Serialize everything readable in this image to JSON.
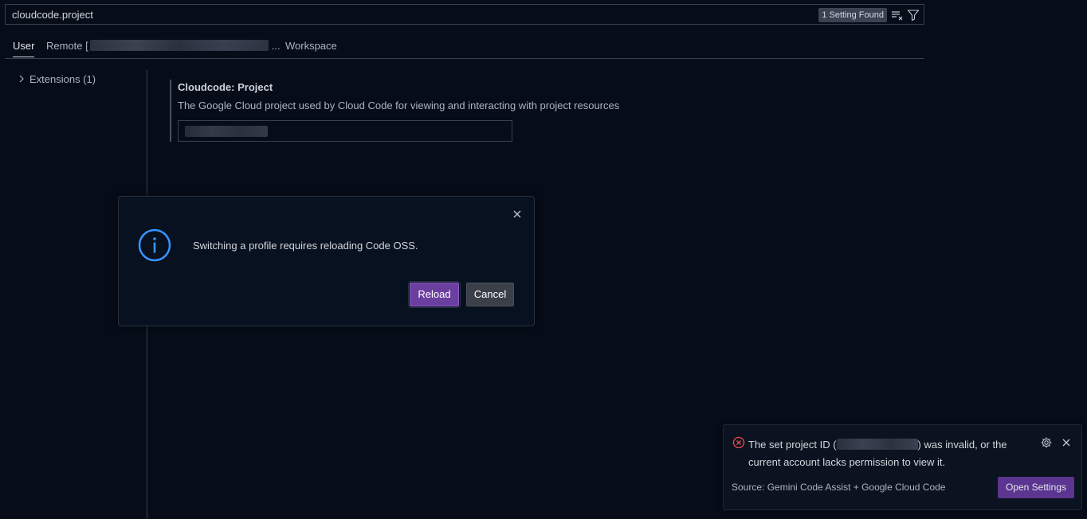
{
  "search": {
    "value": "cloudcode.project",
    "result_count": "1 Setting Found",
    "clear_icon": "clear-filter-icon",
    "filter_icon": "filter-icon"
  },
  "tabs": {
    "user": "User",
    "remote_prefix": "Remote [",
    "remote_suffix": "...",
    "workspace": "Workspace"
  },
  "toc": {
    "extensions": "Extensions (1)"
  },
  "setting": {
    "category": "Cloudcode: ",
    "name": "Project",
    "description": "The Google Cloud project used by Cloud Code for viewing and interacting with project resources"
  },
  "dialog": {
    "message": "Switching a profile requires reloading Code OSS.",
    "reload_label": "Reload",
    "cancel_label": "Cancel",
    "icon": "info-icon",
    "accent_color": "#3794ff",
    "primary_button_color": "#6b3fa0"
  },
  "notification": {
    "message_part1": "The set project ID (",
    "message_part2": ") was invalid, or the current account lacks permission to view it.",
    "source": "Source: Gemini Code Assist + Google Cloud Code",
    "button_label": "Open Settings",
    "icon": "error-icon",
    "error_color": "#f14c4c"
  }
}
